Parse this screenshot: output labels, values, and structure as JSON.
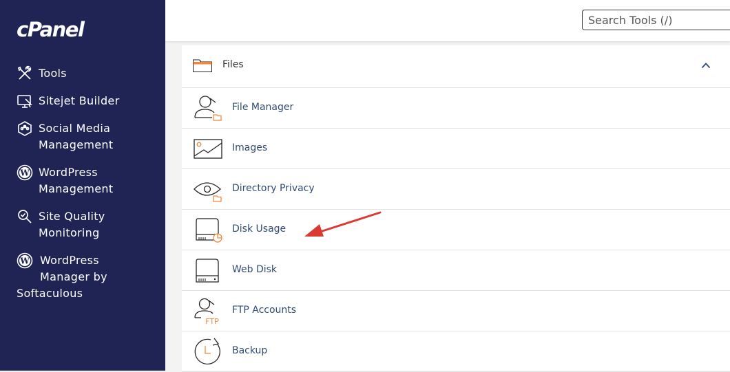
{
  "app": {
    "logo": "cPanel"
  },
  "sidebar": {
    "items": [
      {
        "lines": [
          "Tools"
        ],
        "icon": "tools-icon"
      },
      {
        "lines": [
          "Sitejet Builder"
        ],
        "icon": "sitejet-icon"
      },
      {
        "lines": [
          "Social Media",
          "Management"
        ],
        "icon": "social-media-icon"
      },
      {
        "lines": [
          "WordPress",
          "Management"
        ],
        "icon": "wordpress-icon"
      },
      {
        "lines": [
          "Site Quality",
          "Monitoring"
        ],
        "icon": "site-quality-icon"
      },
      {
        "lines": [
          "WordPress",
          "Manager by",
          "Softaculous"
        ],
        "icon": "wordpress-icon"
      }
    ]
  },
  "search": {
    "placeholder": "Search Tools (/)",
    "value": ""
  },
  "panel": {
    "title": "Files",
    "items": [
      {
        "label": "File Manager",
        "icon": "file-manager-icon"
      },
      {
        "label": "Images",
        "icon": "images-icon"
      },
      {
        "label": "Directory Privacy",
        "icon": "directory-privacy-icon"
      },
      {
        "label": "Disk Usage",
        "icon": "disk-usage-icon"
      },
      {
        "label": "Web Disk",
        "icon": "web-disk-icon"
      },
      {
        "label": "FTP Accounts",
        "icon": "ftp-accounts-icon",
        "icon_text": "FTP"
      },
      {
        "label": "Backup",
        "icon": "backup-icon"
      }
    ]
  },
  "colors": {
    "sidebar_bg": "#1f2455",
    "accent_orange": "#f0883e",
    "link": "#2f4b73",
    "annotation_arrow": "#d93a31"
  }
}
